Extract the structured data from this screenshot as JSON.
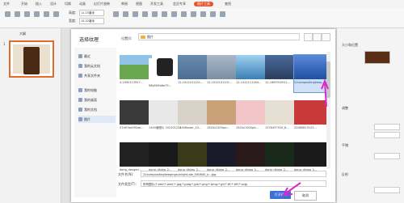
{
  "ribbon": {
    "menu": [
      "文件",
      "开始",
      "插入",
      "设计",
      "切换",
      "动画",
      "幻灯片放映",
      "审阅",
      "视图",
      "开发工具",
      "会员专享",
      "图片工具",
      "查找"
    ],
    "active_menu": "图片工具",
    "height_label": "高度:",
    "height_value": "11.15厘米",
    "width_label": "宽度:",
    "width_value": "15.22厘米",
    "size_label": "大小和位置"
  },
  "left_panel": {
    "tab_label": "大纲",
    "slide_number": "1"
  },
  "right_panel": {
    "label1": "大小和位置",
    "label2": "调整",
    "label3": "平铺",
    "label4": "反射"
  },
  "dialog": {
    "title": "选择纹理",
    "location_label": "位置(I):",
    "location_value": "图片",
    "sidebar": [
      {
        "label": "最近",
        "icon": "recent-icon"
      },
      {
        "label": "我的云文档",
        "icon": "cloud-icon"
      },
      {
        "label": "共享文件夹",
        "icon": "share-icon"
      },
      {
        "label": "我的电脑",
        "icon": "computer-icon"
      },
      {
        "label": "我的桌面",
        "icon": "desktop-icon"
      },
      {
        "label": "我的文档",
        "icon": "documents-icon"
      },
      {
        "label": "图片",
        "icon": "pictures-icon"
      }
    ],
    "files": [
      {
        "name": "4-1950113557...",
        "color": "#6aa84f"
      },
      {
        "name": "98b5f4fa6e79...",
        "color": "#222222"
      },
      {
        "name": "12-1012101101...",
        "color": "#4c6e91"
      },
      {
        "name": "12-1012101101...",
        "color": "#7a8fa6"
      },
      {
        "name": "12-1412111164...",
        "color": "#3b7fb4"
      },
      {
        "name": "12-1609310911...",
        "color": "#2a3f5f"
      },
      {
        "name": "22compositingkeep...ale_050840_b...",
        "color": "#1f4fa0"
      },
      {
        "name": "57a97ae092ab...",
        "color": "#3a3a3a"
      },
      {
        "name": "1440面图片 20210121113...",
        "color": "#e8e8e8"
      },
      {
        "name": "1440flower_10...",
        "color": "#d8d2c8"
      },
      {
        "name": "1920x1200pic...",
        "color": "#c9a27a"
      },
      {
        "name": "1920x1200pic...",
        "color": "#f2c6c9"
      },
      {
        "name": "1378437520_8...",
        "color": "#e6e0d4"
      },
      {
        "name": "20080813123...",
        "color": "#c83a3a"
      },
      {
        "name": "dong_dongen...",
        "color": "#222222"
      },
      {
        "name": "dong_dhiwa_2...",
        "color": "#1a1a1a"
      },
      {
        "name": "dong_dhiwa_2...",
        "color": "#3a3a1a"
      },
      {
        "name": "dong_dhiwa_2...",
        "color": "#1a1a2a"
      },
      {
        "name": "dong_dhiwa_2...",
        "color": "#2a1a1a"
      },
      {
        "name": "dong_dhiwa_2...",
        "color": "#1a2a1a"
      },
      {
        "name": "dong_dhiwa_2...",
        "color": "#1a1a1a"
      }
    ],
    "filename_label": "文件名(N):",
    "filename_value": "22compositingkeepingsunlight-ale_050840_b...jpg",
    "filetype_label": "文件类型(T):",
    "filetype_value": "所有图片(*.emf;*.wmf;*.jpg;*.jpeg;*.jpe;*.png;*.bmp;*.gif;*.tif;*.tiff;*.svg)",
    "open_button": "打开(O)",
    "cancel_button": "取消"
  },
  "colors": {
    "accent": "#e46a2d",
    "primary": "#3d6fd8",
    "annotation": "#d62bc8"
  }
}
